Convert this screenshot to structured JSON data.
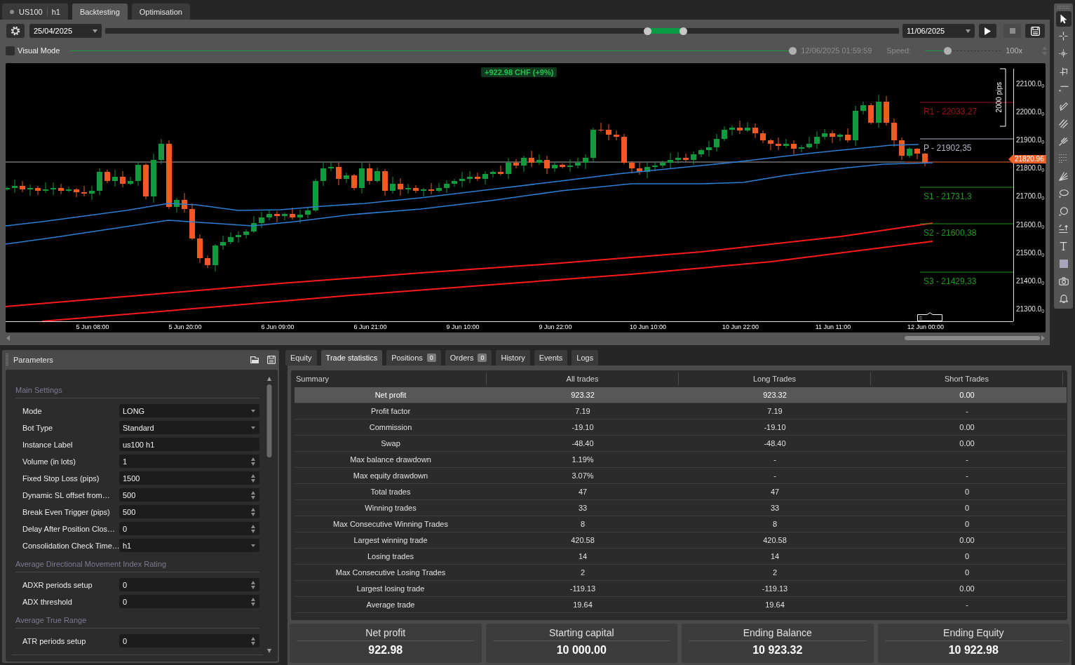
{
  "tabs": [
    {
      "kind": "symbol",
      "symbol": "US100",
      "timeframe": "h1",
      "selected": false
    },
    {
      "kind": "label",
      "label": "Backtesting",
      "selected": true
    },
    {
      "kind": "label",
      "label": "Optimisation",
      "selected": false
    }
  ],
  "controls": {
    "start_date": "25/04/2025",
    "range": {
      "thumbs": [
        {
          "level": 0.685
        },
        {
          "level": 0.731
        }
      ]
    },
    "end_date": "11/06/2025",
    "stop": {
      "disabled": true
    }
  },
  "visual_mode": {
    "label": "Visual Mode",
    "checked": false,
    "progress": {
      "level": 1
    },
    "time": "12/06/2025 01:59:59",
    "speed_label": "Speed:",
    "speed": {
      "level": 0.28
    },
    "speed_value": "100x"
  },
  "chart": {
    "profit_badge": "+922.98 CHF (+9%)",
    "range_marker": "2000 pips",
    "pivots": [
      {
        "label": "R1 - 22033,27",
        "color": "#a01414"
      },
      {
        "label": "P - 21902,35",
        "color": "#b4b4c8"
      },
      {
        "label": "S1 - 21731,3",
        "color": "#1f9a1f"
      },
      {
        "label": "S2 - 21600,38",
        "color": "#1f9a1f"
      },
      {
        "label": "S3 - 21429,33",
        "color": "#1f9a1f"
      }
    ],
    "current_price": "21820.96",
    "price_ticks": [
      "22100.0$_{0}$",
      "22000.0$_{0}$",
      "21900.0$_{0}$",
      "21800.0$_{0}$",
      "21700.0$_{0}$",
      "21600.0$_{0}$",
      "21500.0$_{0}$",
      "21400.0$_{0}$",
      "21300.0$_{0}$"
    ],
    "time_ticks": [
      "5 Jun 08:00",
      "5 Jun 20:00",
      "6 Jun 09:00",
      "6 Jun 21:00",
      "9 Jun 10:00",
      "9 Jun 22:00",
      "10 Jun 10:00",
      "10 Jun 22:00",
      "11 Jun 11:00",
      "12 Jun 00:00"
    ]
  },
  "toolbar": {
    "tools": [
      {
        "kind": "cursor",
        "selected": true
      },
      {
        "kind": "crosshair",
        "selected": false
      },
      {
        "kind": "crosshair_fine",
        "selected": false
      },
      {
        "kind": "measure",
        "selected": false
      },
      {
        "kind": "line",
        "selected": false
      },
      {
        "kind": "pencil",
        "selected": false
      },
      {
        "kind": "channel",
        "selected": false
      },
      {
        "kind": "pitchfork",
        "selected": false
      },
      {
        "kind": "fibonacci",
        "selected": false
      },
      {
        "kind": "fan",
        "selected": false
      },
      {
        "kind": "ellipse",
        "selected": false
      },
      {
        "kind": "circle",
        "selected": false
      },
      {
        "kind": "level",
        "selected": false
      },
      {
        "kind": "text",
        "selected": false
      },
      {
        "kind": "rectangle",
        "selected": false
      },
      {
        "kind": "camera",
        "selected": false
      },
      {
        "kind": "alert",
        "selected": false
      }
    ]
  },
  "parameters": {
    "title": "Parameters",
    "sections": [
      {
        "title": "Main Settings",
        "fields": [
          {
            "label": "Mode",
            "kind": "dropdown",
            "value": "LONG"
          },
          {
            "label": "Bot Type",
            "kind": "dropdown",
            "value": "Standard"
          },
          {
            "label": "Instance Label",
            "kind": "text",
            "value": "us100 h1"
          },
          {
            "label": "Volume (in lots)",
            "kind": "number",
            "value": "1"
          },
          {
            "label": "Fixed Stop Loss (pips)",
            "kind": "number",
            "value": "1500"
          },
          {
            "label": "Dynamic SL offset from…",
            "kind": "number",
            "value": "500"
          },
          {
            "label": "Break Even Trigger (pips)",
            "kind": "number",
            "value": "500"
          },
          {
            "label": "Delay After Position Clos…",
            "kind": "number",
            "value": "0"
          },
          {
            "label": "Consolidation Check Time…",
            "kind": "dropdown",
            "value": "h1"
          }
        ]
      },
      {
        "title": "Average Directional Movement Index Rating",
        "fields": [
          {
            "label": "ADXR periods setup",
            "kind": "number",
            "value": "0"
          },
          {
            "label": "ADX threshold",
            "kind": "number",
            "value": "0"
          }
        ]
      },
      {
        "title": "Average True Range",
        "fields": [
          {
            "label": "ATR periods setup",
            "kind": "number",
            "value": "0"
          }
        ]
      }
    ]
  },
  "results": {
    "tabs": [
      {
        "label": "Equity",
        "selected": false
      },
      {
        "label": "Trade statistics",
        "selected": true
      },
      {
        "label": "Positions",
        "badge": "0",
        "selected": false
      },
      {
        "label": "Orders",
        "badge": "0",
        "selected": false
      },
      {
        "label": "History",
        "selected": false
      },
      {
        "label": "Events",
        "selected": false
      },
      {
        "label": "Logs",
        "selected": false
      }
    ],
    "statistics": {
      "columns": [
        "Summary",
        "All trades",
        "Long Trades",
        "Short Trades"
      ],
      "rows": [
        {
          "cells": [
            "Net profit",
            "923.32",
            "923.32",
            "0.00"
          ],
          "selected": true
        },
        {
          "cells": [
            "Profit factor",
            "7.19",
            "7.19",
            "-"
          ],
          "selected": false
        },
        {
          "cells": [
            "Commission",
            "-19.10",
            "-19.10",
            "0.00"
          ],
          "selected": false
        },
        {
          "cells": [
            "Swap",
            "-48.40",
            "-48.40",
            "0.00"
          ],
          "selected": false
        },
        {
          "cells": [
            "Max balance drawdown",
            "1.19%",
            "-",
            "-"
          ],
          "selected": false
        },
        {
          "cells": [
            "Max equity drawdown",
            "3.07%",
            "-",
            "-"
          ],
          "selected": false
        },
        {
          "cells": [
            "Total trades",
            "47",
            "47",
            "0"
          ],
          "selected": false
        },
        {
          "cells": [
            "Winning trades",
            "33",
            "33",
            "0"
          ],
          "selected": false
        },
        {
          "cells": [
            "Max Consecutive Winning Trades",
            "8",
            "8",
            "0"
          ],
          "selected": false
        },
        {
          "cells": [
            "Largest winning trade",
            "420.58",
            "420.58",
            "0.00"
          ],
          "selected": false
        },
        {
          "cells": [
            "Losing trades",
            "14",
            "14",
            "0"
          ],
          "selected": false
        },
        {
          "cells": [
            "Max Consecutive Losing Trades",
            "2",
            "2",
            "0"
          ],
          "selected": false
        },
        {
          "cells": [
            "Largest losing trade",
            "-119.13",
            "-119.13",
            "0.00"
          ],
          "selected": false
        },
        {
          "cells": [
            "Average trade",
            "19.64",
            "19.64",
            "-"
          ],
          "selected": false
        }
      ]
    },
    "summary": [
      {
        "label": "Net profit",
        "value": "922.98"
      },
      {
        "label": "Starting capital",
        "value": "10 000.00"
      },
      {
        "label": "Ending Balance",
        "value": "10 923.32"
      },
      {
        "label": "Ending Equity",
        "value": "10 922.98"
      }
    ]
  }
}
